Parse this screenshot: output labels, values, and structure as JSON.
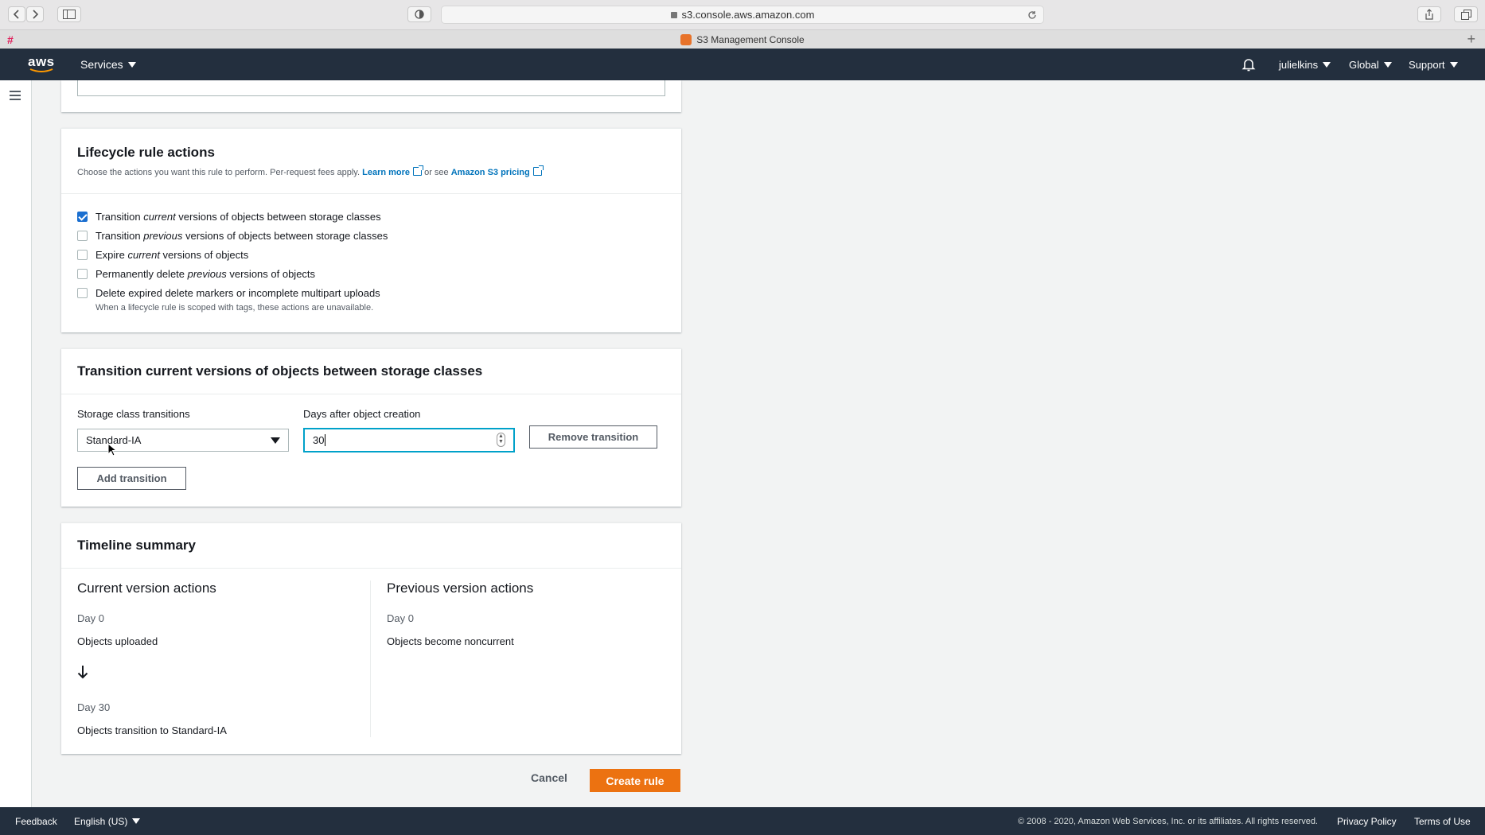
{
  "browser": {
    "url": "s3.console.aws.amazon.com",
    "tab_title": "S3 Management Console"
  },
  "aws_nav": {
    "logo": "aws",
    "services": "Services",
    "user": "julielkins",
    "region": "Global",
    "support": "Support"
  },
  "lifecycle": {
    "title": "Lifecycle rule actions",
    "desc": "Choose the actions you want this rule to perform. Per-request fees apply.",
    "learn_more": "Learn more",
    "or_see": "or see",
    "pricing": "Amazon S3 pricing",
    "options": [
      {
        "pre": "Transition ",
        "em": "current",
        "post": " versions of objects between storage classes",
        "checked": true
      },
      {
        "pre": "Transition ",
        "em": "previous",
        "post": " versions of objects between storage classes",
        "checked": false
      },
      {
        "pre": "Expire ",
        "em": "current",
        "post": " versions of objects",
        "checked": false
      },
      {
        "pre": "Permanently delete ",
        "em": "previous",
        "post": " versions of objects",
        "checked": false
      },
      {
        "pre": "Delete expired delete markers or incomplete multipart uploads",
        "em": "",
        "post": "",
        "checked": false
      }
    ],
    "note": "When a lifecycle rule is scoped with tags, these actions are unavailable."
  },
  "transition": {
    "title": "Transition current versions of objects between storage classes",
    "storage_label": "Storage class transitions",
    "storage_value": "Standard-IA",
    "days_label": "Days after object creation",
    "days_value": "30",
    "remove": "Remove transition",
    "add": "Add transition"
  },
  "timeline": {
    "title": "Timeline summary",
    "current_head": "Current version actions",
    "current_day0": "Day 0",
    "current_day0_text": "Objects uploaded",
    "current_day30": "Day 30",
    "current_day30_text": "Objects transition to Standard-IA",
    "previous_head": "Previous version actions",
    "previous_day0": "Day 0",
    "previous_day0_text": "Objects become noncurrent"
  },
  "actions": {
    "cancel": "Cancel",
    "create": "Create rule",
    "create_color": "#ec7211"
  },
  "footer": {
    "feedback": "Feedback",
    "language": "English (US)",
    "copyright": "© 2008 - 2020, Amazon Web Services, Inc. or its affiliates. All rights reserved.",
    "privacy": "Privacy Policy",
    "terms": "Terms of Use"
  }
}
